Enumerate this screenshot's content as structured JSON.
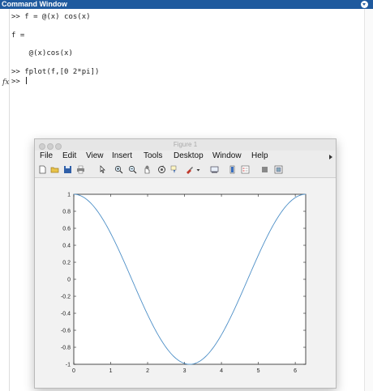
{
  "command_window": {
    "title": "Command Window",
    "lines": [
      ">> f = @(x) cos(x)",
      "f =",
      "    @(x)cos(x)",
      ">> fplot(f,[0 2*pi])",
      ">> "
    ],
    "fx_label": "fx"
  },
  "figure": {
    "title": "Figure 1",
    "menu": [
      "File",
      "Edit",
      "View",
      "Insert",
      "Tools",
      "Desktop",
      "Window",
      "Help"
    ],
    "toolbar_icons": [
      "new-file-icon",
      "open-folder-icon",
      "save-icon",
      "print-icon",
      "pointer-icon",
      "zoom-in-icon",
      "zoom-out-icon",
      "pan-icon",
      "rotate-icon",
      "data-cursor-icon",
      "brush-icon",
      "link-icon",
      "insert-colorbar-icon",
      "insert-legend-icon",
      "hide-tools-icon",
      "show-tools-icon"
    ]
  },
  "chart_data": {
    "type": "line",
    "title": "",
    "xlabel": "",
    "ylabel": "",
    "xlim": [
      0,
      6.2832
    ],
    "ylim": [
      -1,
      1
    ],
    "x_ticks": [
      "0",
      "1",
      "2",
      "3",
      "4",
      "5",
      "6"
    ],
    "y_ticks": [
      "1",
      "0.8",
      "0.6",
      "0.4",
      "0.2",
      "0",
      "-0.2",
      "-0.4",
      "-0.6",
      "-0.8",
      "-1"
    ],
    "grid": false,
    "series": [
      {
        "function": "cos(x)",
        "x_range": [
          0,
          6.2832
        ],
        "color": "#4d8fc7"
      }
    ]
  }
}
